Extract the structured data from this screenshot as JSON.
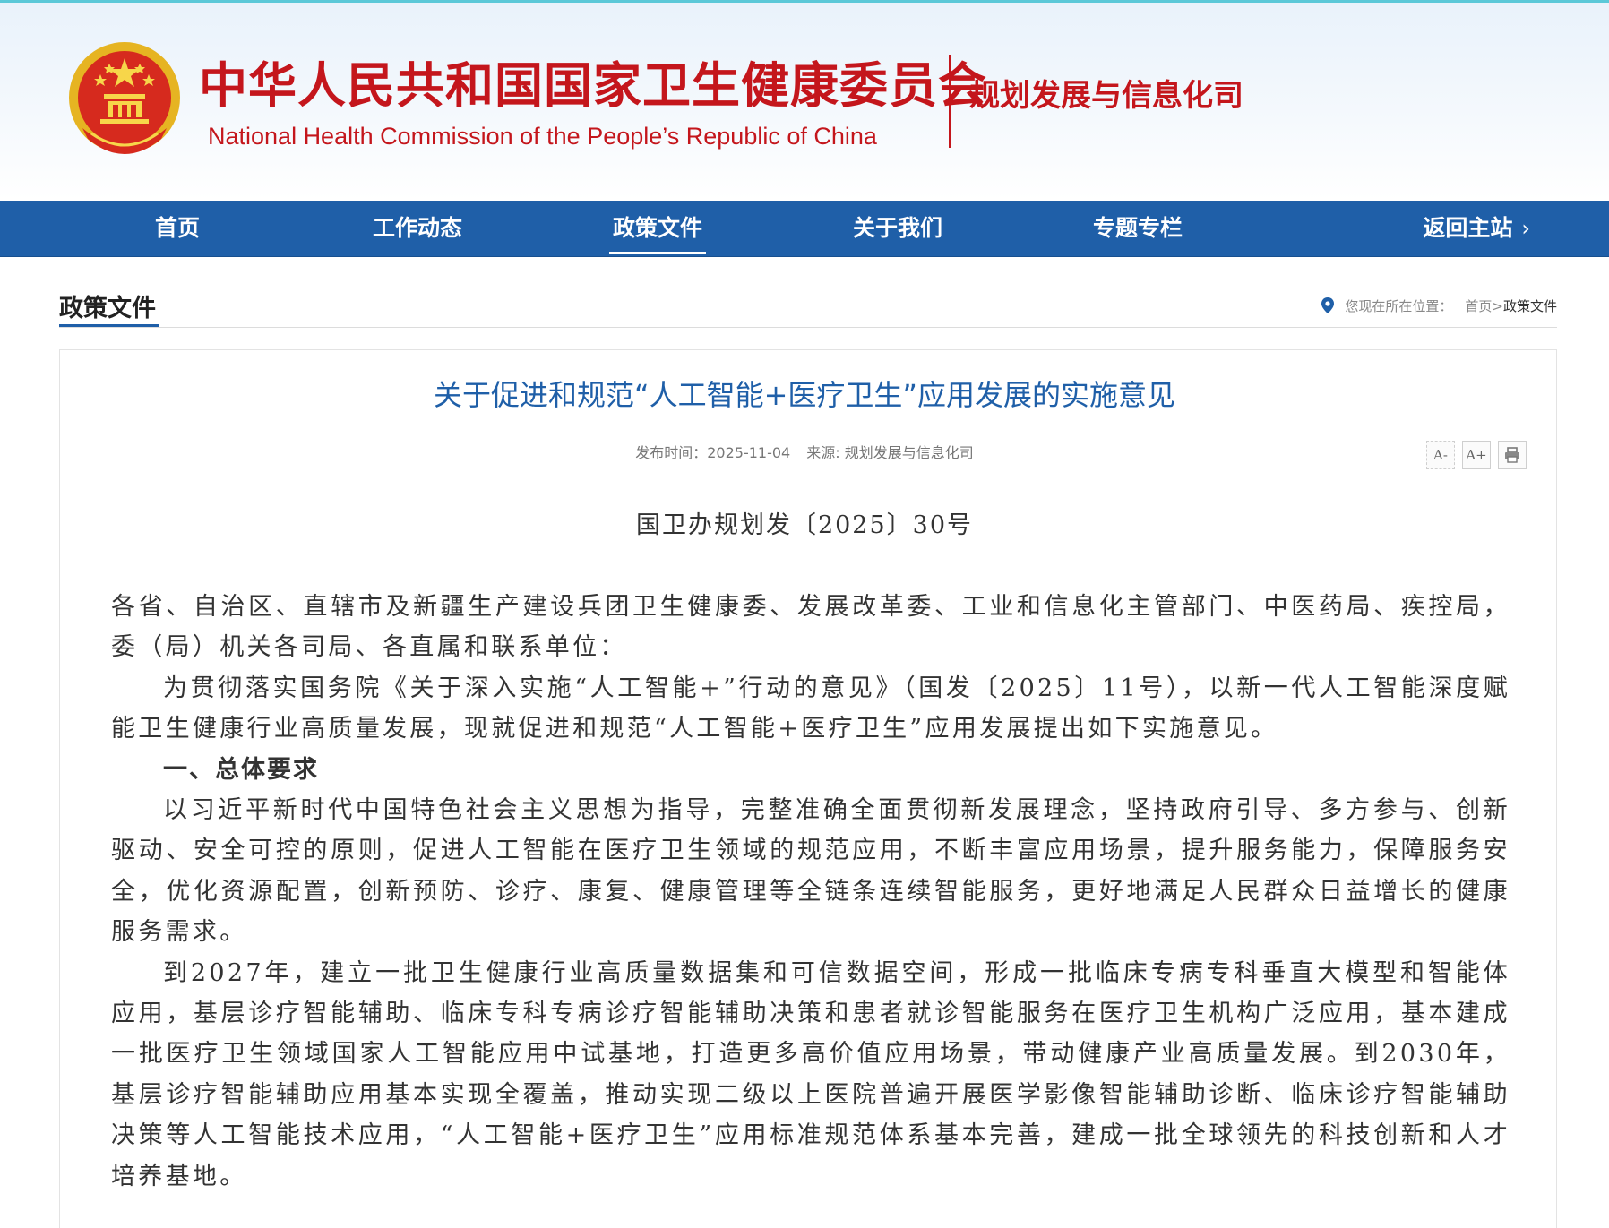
{
  "header": {
    "title_cn": "中华人民共和国国家卫生健康委员会",
    "title_en": "National Health Commission of the People’s  Republic of China",
    "department": "规划发展与信息化司",
    "emblem_icon": "national-emblem",
    "brand_color": "#c4161c"
  },
  "nav": {
    "items": [
      {
        "label": "首页"
      },
      {
        "label": "工作动态"
      },
      {
        "label": "政策文件"
      },
      {
        "label": "关于我们"
      },
      {
        "label": "专题专栏"
      }
    ],
    "active": "政策文件",
    "home_link": "返回主站",
    "background": "#1f5fa8"
  },
  "section": {
    "title": "政策文件",
    "breadcrumb_prefix": "您现在所在位置：",
    "breadcrumb_home": "首页",
    "breadcrumb_sep": ">",
    "breadcrumb_current": "政策文件"
  },
  "article": {
    "title": "关于促进和规范“人工智能+医疗卫生”应用发展的实施意见",
    "date_label": "发布时间：",
    "date": "2025-11-04",
    "source_label": "来源:",
    "source": "规划发展与信息化司",
    "tools": {
      "font_smaller": "A-",
      "font_larger": "A+",
      "print_icon": "print-icon"
    },
    "doc_number": "国卫办规划发〔2025〕30号",
    "paragraphs": [
      "各省、自治区、直辖市及新疆生产建设兵团卫生健康委、发展改革委、工业和信息化主管部门、中医药局、疾控局，委（局）机关各司局、各直属和联系单位：",
      "为贯彻落实国务院《关于深入实施“人工智能+”行动的意见》（国发〔2025〕11号），以新一代人工智能深度赋能卫生健康行业高质量发展，现就促进和规范“人工智能+医疗卫生”应用发展提出如下实施意见。",
      "一、总体要求",
      "以习近平新时代中国特色社会主义思想为指导，完整准确全面贯彻新发展理念，坚持政府引导、多方参与、创新驱动、安全可控的原则，促进人工智能在医疗卫生领域的规范应用，不断丰富应用场景，提升服务能力，保障服务安全，优化资源配置，创新预防、诊疗、康复、健康管理等全链条连续智能服务，更好地满足人民群众日益增长的健康服务需求。",
      "到2027年，建立一批卫生健康行业高质量数据集和可信数据空间，形成一批临床专病专科垂直大模型和智能体应用，基层诊疗智能辅助、临床专科专病诊疗智能辅助决策和患者就诊智能服务在医疗卫生机构广泛应用，基本建成一批医疗卫生领域国家人工智能应用中试基地，打造更多高价值应用场景，带动健康产业高质量发展。到2030年，基层诊疗智能辅助应用基本实现全覆盖，推动实现二级以上医院普遍开展医学影像智能辅助诊断、临床诊疗智能辅助决策等人工智能技术应用，“人工智能+医疗卫生”应用标准规范体系基本完善，建成一批全球领先的科技创新和人才培养基地。"
    ]
  }
}
